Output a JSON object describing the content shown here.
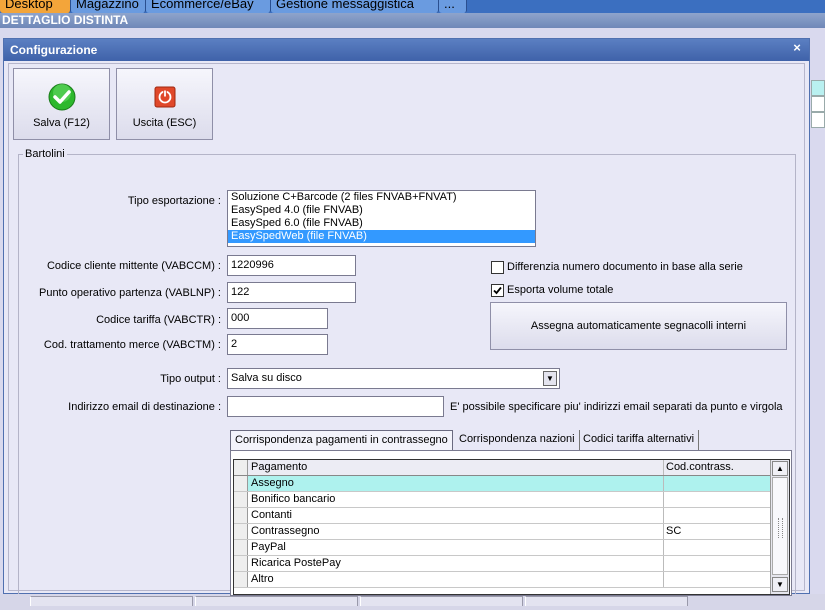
{
  "app_tabs": [
    {
      "label": "Desktop",
      "active": true
    },
    {
      "label": "Magazzino",
      "active": false
    },
    {
      "label": "Ecommerce/eBay",
      "active": false
    },
    {
      "label": "Gestione messaggistica",
      "active": false
    },
    {
      "label": "...",
      "active": false
    }
  ],
  "section_bar": "DETTAGLIO DISTINTA",
  "dialog": {
    "title": "Configurazione",
    "close_glyph": "×",
    "toolbar": {
      "save_label": "Salva (F12)",
      "exit_label": "Uscita (ESC)"
    },
    "group_label": "Bartolini",
    "tipo_esportazione": {
      "label": "Tipo esportazione :",
      "options": [
        "Soluzione C+Barcode (2 files FNVAB+FNVAT)",
        "EasySped 4.0 (file FNVAB)",
        "EasySped 6.0 (file FNVAB)",
        "EasySpedWeb (file FNVAB)"
      ],
      "selected_index": 3
    },
    "fields": {
      "codice_cliente": {
        "label": "Codice cliente mittente (VABCCM) :",
        "value": "1220996"
      },
      "punto_operativo": {
        "label": "Punto operativo partenza (VABLNP) :",
        "value": "122"
      },
      "codice_tariffa": {
        "label": "Codice tariffa (VABCTR) :",
        "value": "000"
      },
      "cod_trattamento": {
        "label": "Cod. trattamento merce (VABCTM) :",
        "value": "2"
      }
    },
    "checkboxes": {
      "differenzia": {
        "label": "Differenzia numero documento in base alla serie",
        "checked": false
      },
      "esporta_volume": {
        "label": "Esporta volume totale",
        "checked": true
      }
    },
    "assegna_button": "Assegna automaticamente segnacolli interni",
    "tipo_output": {
      "label": "Tipo output :",
      "value": "Salva su disco"
    },
    "email": {
      "label": "Indirizzo email di destinazione :",
      "value": "",
      "hint": "E' possibile specificare piu' indirizzi email separati da punto e virgola"
    },
    "tabs": [
      {
        "label": "Corrispondenza pagamenti in contrassegno",
        "active": true
      },
      {
        "label": "Corrispondenza nazioni",
        "active": false
      },
      {
        "label": "Codici tariffa alternativi",
        "active": false
      }
    ],
    "grid": {
      "columns": [
        "Pagamento",
        "Cod.contrass."
      ],
      "rows": [
        [
          "Assegno",
          ""
        ],
        [
          "Bonifico bancario",
          ""
        ],
        [
          "Contanti",
          ""
        ],
        [
          "Contrassegno",
          "SC"
        ],
        [
          "PayPal",
          ""
        ],
        [
          "Ricarica PostePay",
          ""
        ],
        [
          "Altro",
          ""
        ]
      ],
      "highlighted_row": 0
    }
  },
  "colors": {
    "title_bar": "#4a6fb8",
    "active_tab": "#f3a53a",
    "selection": "#3399ff",
    "row_highlight": "#aef2ee",
    "save_icon": "#2db82d",
    "exit_icon": "#e0482a"
  }
}
